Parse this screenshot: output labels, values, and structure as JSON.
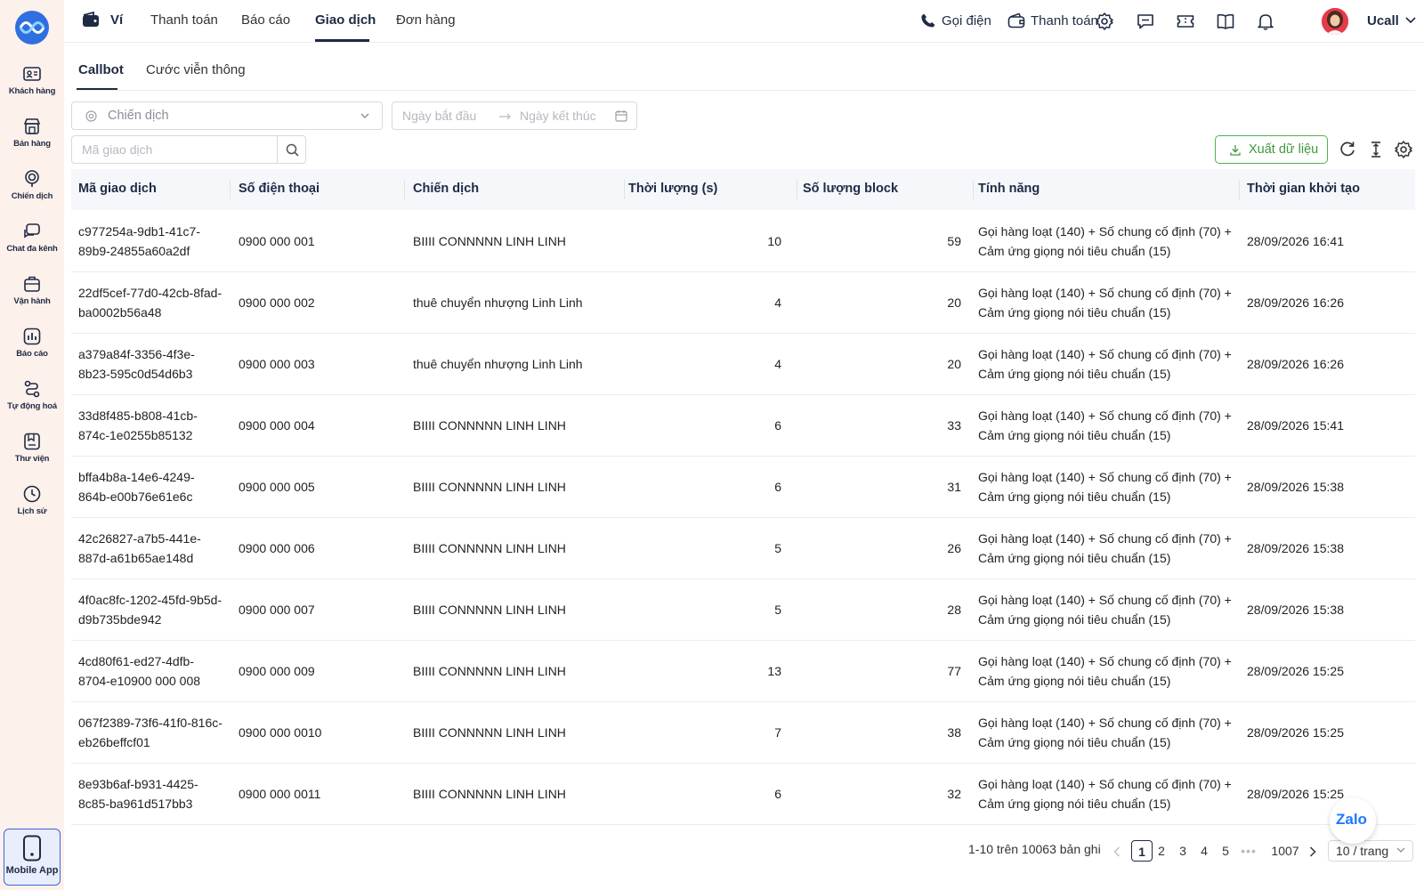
{
  "sidebar": {
    "items": [
      {
        "label": "Khách hàng",
        "icon": "customer-card-icon"
      },
      {
        "label": "Bán hàng",
        "icon": "store-icon"
      },
      {
        "label": "Chiến dịch",
        "icon": "campaign-icon"
      },
      {
        "label": "Chat đa kênh",
        "icon": "chat-icon"
      },
      {
        "label": "Vận hành",
        "icon": "briefcase-icon"
      },
      {
        "label": "Báo cáo",
        "icon": "report-icon"
      },
      {
        "label": "Tự động hoá",
        "icon": "automation-icon"
      },
      {
        "label": "Thư viện",
        "icon": "library-icon"
      },
      {
        "label": "Lịch sử",
        "icon": "history-icon"
      }
    ],
    "mobile_app": "Mobile App"
  },
  "topnav": {
    "wallet": "Ví",
    "links": [
      "Thanh toán",
      "Báo cáo",
      "Giao dịch",
      "Đơn hàng"
    ],
    "active": "Giao dịch",
    "call": "Gọi điện",
    "payment": "Thanh toán",
    "username": "Ucall"
  },
  "subtabs": [
    "Callbot",
    "Cước viễn thông"
  ],
  "filters": {
    "campaign_placeholder": "Chiến dịch",
    "start_date_placeholder": "Ngày bắt đầu",
    "end_date_placeholder": "Ngày kết thúc",
    "search_placeholder": "Mã giao dịch",
    "export_label": "Xuất dữ liệu"
  },
  "table": {
    "headers": [
      "Mã giao dịch",
      "Số điện thoại",
      "Chiến dịch",
      "Thời lượng (s)",
      "Số lượng block",
      "Tính năng",
      "Thời gian khởi tạo"
    ],
    "rows": [
      {
        "id1": "c977254a-9db1-41c7-",
        "id2": "89b9-24855a60a2df",
        "phone": "0900 000 001",
        "campaign": "BIIII CONNNNN LINH LINH",
        "duration": "59",
        "blocks": "10",
        "f1": "Gọi hàng loạt (140) + Số chung cố định (70) +",
        "f2": "Cảm ứng giọng nói tiêu chuẩn (15)",
        "time": "28/09/2026 16:41"
      },
      {
        "id1": "22df5cef-77d0-42cb-8fad-",
        "id2": "ba0002b56a48",
        "phone": "0900 000 002",
        "campaign": "thuê chuyển nhượng Linh Linh",
        "duration": "20",
        "blocks": "4",
        "f1": "Gọi hàng loạt (140) + Số chung cố định (70) +",
        "f2": "Cảm ứng giọng nói tiêu chuẩn (15)",
        "time": "28/09/2026 16:26"
      },
      {
        "id1": "a379a84f-3356-4f3e-",
        "id2": "8b23-595c0d54d6b3",
        "phone": "0900 000 003",
        "campaign": "thuê chuyển nhượng Linh Linh",
        "duration": "20",
        "blocks": "4",
        "f1": "Gọi hàng loạt (140) + Số chung cố định (70) +",
        "f2": "Cảm ứng giọng nói tiêu chuẩn (15)",
        "time": "28/09/2026 16:26"
      },
      {
        "id1": "33d8f485-b808-41cb-",
        "id2": "874c-1e0255b85132",
        "phone": "0900 000 004",
        "campaign": "BIIII CONNNNN LINH LINH",
        "duration": "33",
        "blocks": "6",
        "f1": "Gọi hàng loạt (140) + Số chung cố định (70) +",
        "f2": "Cảm ứng giọng nói tiêu chuẩn (15)",
        "time": "28/09/2026 15:41"
      },
      {
        "id1": "bffa4b8a-14e6-4249-",
        "id2": "864b-e00b76e61e6c",
        "phone": "0900 000 005",
        "campaign": "BIIII CONNNNN LINH LINH",
        "duration": "31",
        "blocks": "6",
        "f1": "Gọi hàng loạt (140) + Số chung cố định (70) +",
        "f2": "Cảm ứng giọng nói tiêu chuẩn (15)",
        "time": "28/09/2026 15:38"
      },
      {
        "id1": "42c26827-a7b5-441e-",
        "id2": "887d-a61b65ae148d",
        "phone": "0900 000 006",
        "campaign": "BIIII CONNNNN LINH LINH",
        "duration": "26",
        "blocks": "5",
        "f1": "Gọi hàng loạt (140) + Số chung cố định (70) +",
        "f2": "Cảm ứng giọng nói tiêu chuẩn (15)",
        "time": "28/09/2026 15:38"
      },
      {
        "id1": "4f0ac8fc-1202-45fd-9b5d-",
        "id2": "d9b735bde942",
        "phone": "0900 000 007",
        "campaign": "BIIII CONNNNN LINH LINH",
        "duration": "28",
        "blocks": "5",
        "f1": "Gọi hàng loạt (140) + Số chung cố định (70) +",
        "f2": "Cảm ứng giọng nói tiêu chuẩn (15)",
        "time": "28/09/2026 15:38"
      },
      {
        "id1": "4cd80f61-ed27-4dfb-",
        "id2": "8704-e10900 000 008",
        "phone": "0900 000 009",
        "campaign": "BIIII CONNNNN LINH LINH",
        "duration": "77",
        "blocks": "13",
        "f1": "Gọi hàng loạt (140) + Số chung cố định (70) +",
        "f2": "Cảm ứng giọng nói tiêu chuẩn (15)",
        "time": "28/09/2026 15:25"
      },
      {
        "id1": "067f2389-73f6-41f0-816c-",
        "id2": "eb26beffcf01",
        "phone": "0900 000 0010",
        "campaign": "BIIII CONNNNN LINH LINH",
        "duration": "38",
        "blocks": "7",
        "f1": "Gọi hàng loạt (140) + Số chung cố định (70) +",
        "f2": "Cảm ứng giọng nói tiêu chuẩn (15)",
        "time": "28/09/2026 15:25"
      },
      {
        "id1": "8e93b6af-b931-4425-",
        "id2": "8c85-ba961d517bb3",
        "phone": "0900 000 0011",
        "campaign": "BIIII CONNNNN LINH LINH",
        "duration": "32",
        "blocks": "6",
        "f1": "Gọi hàng loạt (140) + Số chung cố định (70) +",
        "f2": "Cảm ứng giọng nói tiêu chuẩn (15)",
        "time": "28/09/2026 15:25"
      }
    ]
  },
  "pagination": {
    "total_text": "1-10 trên 10063 bản ghi",
    "pages": [
      "1",
      "2",
      "3",
      "4",
      "5",
      "•••",
      "1007"
    ],
    "current": "1",
    "page_size": "10 / trang"
  },
  "zalo": "Zalo"
}
